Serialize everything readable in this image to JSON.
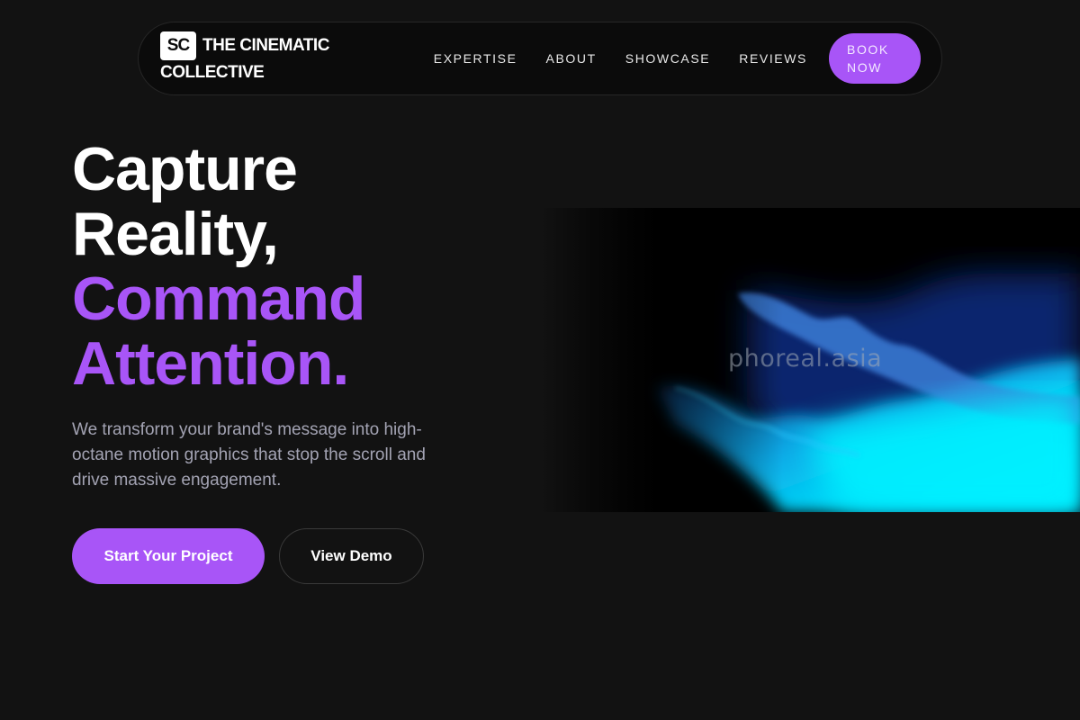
{
  "brand": {
    "logo_initials": "SC",
    "name_line1": "THE CINEMATIC",
    "name_line2": "COLLECTIVE"
  },
  "nav": {
    "links": [
      "EXPERTISE",
      "ABOUT",
      "SHOWCASE",
      "REVIEWS"
    ],
    "book_line1": "BOOK",
    "book_line2": "NOW"
  },
  "hero": {
    "title_line1": "Capture",
    "title_line2": "Reality,",
    "title_line3": "Command",
    "title_line4": "Attention.",
    "subtitle": "We transform your brand's message into high-octane motion graphics that stop the scroll and drive massive engagement.",
    "primary_cta": "Start Your Project",
    "secondary_cta": "View Demo",
    "watermark": "phoreal.asia"
  },
  "colors": {
    "background": "#121212",
    "accent": "#a855f7",
    "nav_bg": "#0b0b0b",
    "subtitle": "#a3a3b3",
    "glow": "#00e5ff"
  }
}
